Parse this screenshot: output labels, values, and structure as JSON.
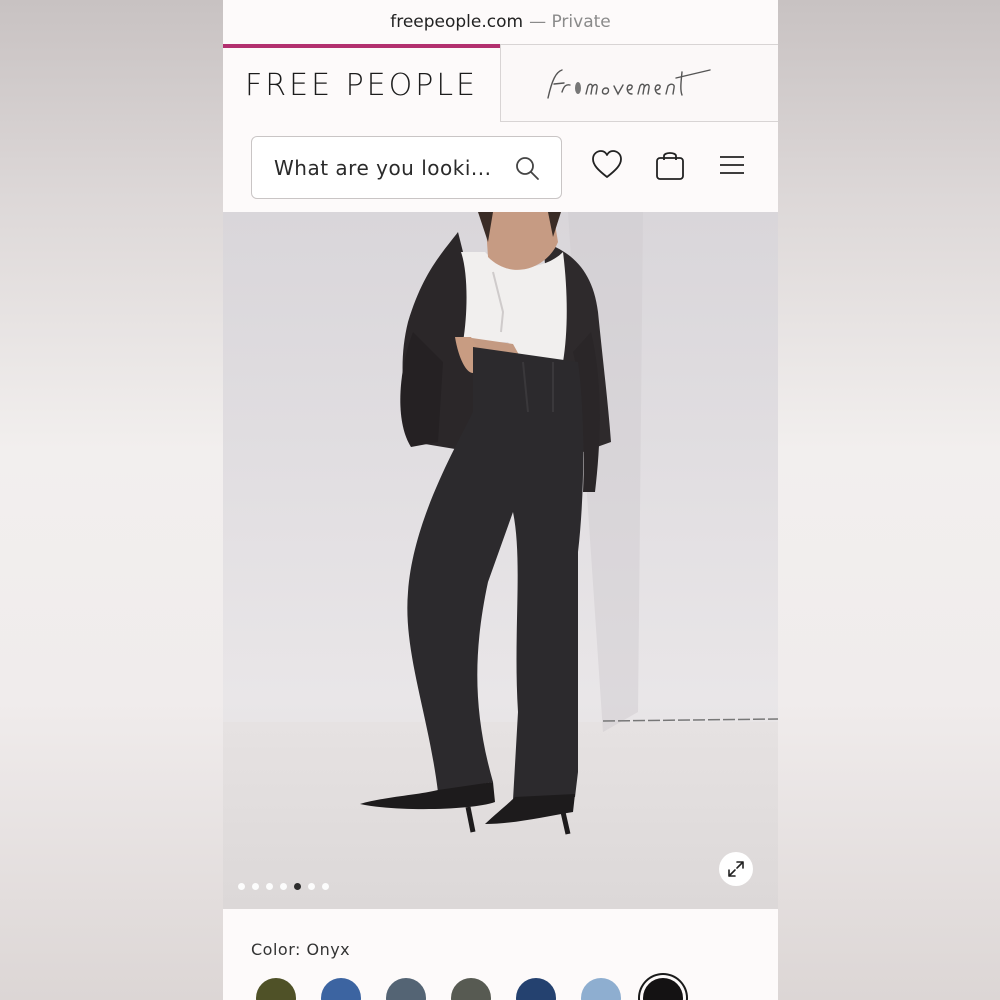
{
  "browser": {
    "domain": "freepeople.com",
    "mode": "Private",
    "separator": "—"
  },
  "tabs": {
    "brand": "FREE PEOPLE",
    "movement_logo": "fpmovement"
  },
  "header": {
    "search_placeholder": "What are you looki...",
    "icons": [
      "search-icon",
      "heart-icon",
      "bag-icon",
      "menu-icon"
    ]
  },
  "gallery": {
    "image_count": 7,
    "active_index": 4,
    "expand_icon": "expand-icon"
  },
  "product": {
    "color_label": "Color: Onyx",
    "swatches": [
      {
        "name": "olive",
        "color": "#4f5127"
      },
      {
        "name": "medium-blue",
        "color": "#3c64a1"
      },
      {
        "name": "slate",
        "color": "#546474"
      },
      {
        "name": "grey-green",
        "color": "#575a52"
      },
      {
        "name": "dark-blue",
        "color": "#24416f"
      },
      {
        "name": "light-blue",
        "color": "#8eaed0"
      },
      {
        "name": "onyx",
        "color": "#141213",
        "selected": true
      }
    ]
  },
  "colors": {
    "accent": "#b3306f"
  }
}
